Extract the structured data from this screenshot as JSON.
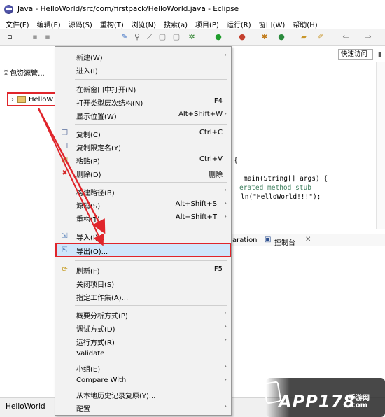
{
  "window": {
    "title": "Java - HelloWorld/src/com/firstpack/HelloWorld.java - Eclipse"
  },
  "menubar": [
    "文件(F)",
    "编辑(E)",
    "源码(S)",
    "重构(T)",
    "浏览(N)",
    "搜索(a)",
    "项目(P)",
    "运行(R)",
    "窗口(W)",
    "帮助(H)"
  ],
  "quick_access": {
    "label": "快速访问"
  },
  "left_panel": {
    "tab_label": "包资源管...",
    "tree_item": "HelloW"
  },
  "editor": {
    "lines": [
      "{",
      "main(String[] args) {",
      "erated method stub",
      "ln(\"HelloWorld!!!\");"
    ]
  },
  "bottom_tabs": {
    "tab1": "aration",
    "tab2": "控制台"
  },
  "status": {
    "text": "HelloWorld"
  },
  "context_menu": {
    "items": [
      {
        "label": "新建(W)",
        "shortcut": "",
        "submenu": true
      },
      {
        "label": "进入(I)",
        "shortcut": "",
        "submenu": false
      },
      {
        "label": "在新窗口中打开(N)",
        "shortcut": "",
        "submenu": false
      },
      {
        "label": "打开类型层次结构(N)",
        "shortcut": "F4",
        "submenu": false
      },
      {
        "label": "显示位置(W)",
        "shortcut": "Alt+Shift+W",
        "submenu": true
      },
      {
        "label": "复制(C)",
        "shortcut": "Ctrl+C",
        "submenu": false
      },
      {
        "label": "复制限定名(Y)",
        "shortcut": "",
        "submenu": false
      },
      {
        "label": "粘贴(P)",
        "shortcut": "Ctrl+V",
        "submenu": false
      },
      {
        "label": "删除(D)",
        "shortcut": "删除",
        "submenu": false
      },
      {
        "label": "构建路径(B)",
        "shortcut": "",
        "submenu": true
      },
      {
        "label": "源码(S)",
        "shortcut": "Alt+Shift+S",
        "submenu": true
      },
      {
        "label": "重构(T)",
        "shortcut": "Alt+Shift+T",
        "submenu": true
      },
      {
        "label": "导入(I)...",
        "shortcut": "",
        "submenu": false
      },
      {
        "label": "导出(O)...",
        "shortcut": "",
        "submenu": false
      },
      {
        "label": "刷新(F)",
        "shortcut": "F5",
        "submenu": false
      },
      {
        "label": "关闭项目(S)",
        "shortcut": "",
        "submenu": false
      },
      {
        "label": "指定工作集(A)...",
        "shortcut": "",
        "submenu": false
      },
      {
        "label": "概要分析方式(P)",
        "shortcut": "",
        "submenu": true
      },
      {
        "label": "调试方式(D)",
        "shortcut": "",
        "submenu": true
      },
      {
        "label": "运行方式(R)",
        "shortcut": "",
        "submenu": true
      },
      {
        "label": "Validate",
        "shortcut": "",
        "submenu": false
      },
      {
        "label": "小组(E)",
        "shortcut": "",
        "submenu": true
      },
      {
        "label": "Compare With",
        "shortcut": "",
        "submenu": true
      },
      {
        "label": "从本地历史记录复原(Y)...",
        "shortcut": "",
        "submenu": false
      },
      {
        "label": "配置",
        "shortcut": "",
        "submenu": true
      }
    ]
  },
  "watermark": {
    "text": "APP178",
    "sub1": "手游网",
    ".com": ".com"
  },
  "colors": {
    "highlight_border": "#e0252b",
    "selection": "#cfe6fb",
    "menu_bg": "#f2f2f2"
  }
}
